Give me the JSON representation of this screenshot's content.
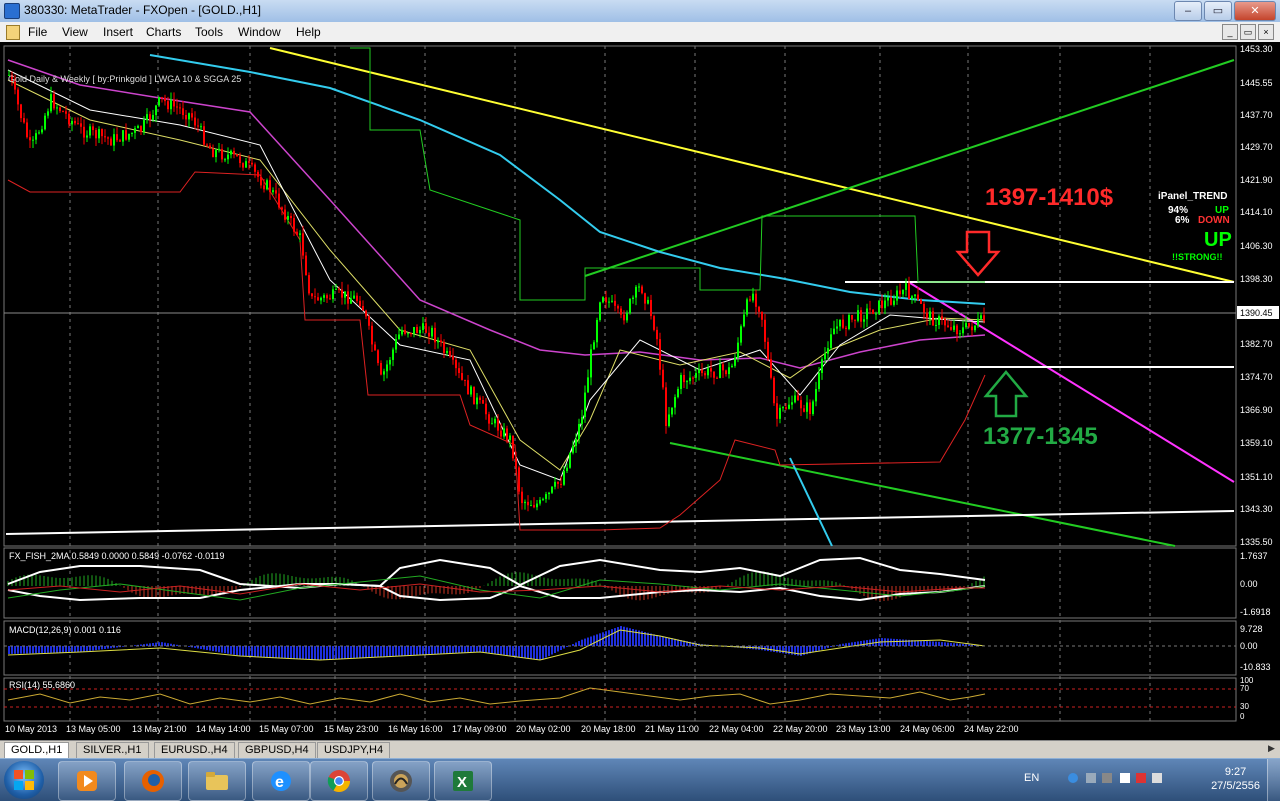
{
  "window": {
    "title": "380330: MetaTrader - FXOpen - [GOLD.,H1]",
    "minimize": "–",
    "maximize": "▭",
    "close": "✕"
  },
  "menu": [
    "File",
    "View",
    "Insert",
    "Charts",
    "Tools",
    "Window",
    "Help"
  ],
  "mdi_buttons": [
    "_",
    "▭",
    "×"
  ],
  "chart": {
    "indicator_label": "Gold Daily & Weekly [ by:Prinkgold ]  LWGA 10  &  SGGA 25",
    "price_axis": [
      "1453.30",
      "1445.55",
      "1437.70",
      "1429.70",
      "1421.90",
      "1414.10",
      "1406.30",
      "1398.30",
      "1390.45",
      "1382.70",
      "1374.70",
      "1366.90",
      "1359.10",
      "1351.10",
      "1343.30",
      "1335.50"
    ],
    "current_price": "1390.45",
    "annotation_resistance": "1397-1410$",
    "annotation_support": "1377-1345",
    "ipanel": {
      "title": "iPanel_TREND",
      "up_pct": "94%",
      "up_label": "UP",
      "down_pct": "6%",
      "down_label": "DOWN",
      "big": "UP",
      "strength": "!!STRONG!!"
    },
    "colors": {
      "bull": "#00ff00",
      "bear": "#ff0000",
      "resistance": "#ff2a2a",
      "support": "#22aa44"
    }
  },
  "fisher": {
    "label": "FX_FISH_2MA 0.5849 0.0000 0.5849 -0.0762 -0.0119",
    "axis": [
      "1.7637",
      "0.00",
      "-1.6918"
    ]
  },
  "macd": {
    "label": "MACD(12,26,9) 0.001 0.116",
    "axis": [
      "9.728",
      "0.00",
      "-10.833"
    ]
  },
  "rsi": {
    "label": "RSI(14) 55.6860",
    "axis": [
      "100",
      "70",
      "30",
      "0"
    ]
  },
  "time_axis": [
    "10 May 2013",
    "13 May 05:00",
    "13 May 21:00",
    "14 May 14:00",
    "15 May 07:00",
    "15 May 23:00",
    "16 May 16:00",
    "17 May 09:00",
    "20 May 02:00",
    "20 May 18:00",
    "21 May 11:00",
    "22 May 04:00",
    "22 May 20:00",
    "23 May 13:00",
    "24 May 06:00",
    "24 May 22:00"
  ],
  "tabs": [
    "GOLD.,H1",
    "SILVER.,H1",
    "EURUSD.,H4",
    "GBPUSD,H4",
    "USDJPY,H4"
  ],
  "tray": {
    "lang": "EN",
    "time": "9:27",
    "date": "27/5/2556"
  },
  "taskbar_icons": [
    "media-player-icon",
    "firefox-icon",
    "folder-icon",
    "ie-icon",
    "chrome-icon",
    "metatrader-icon",
    "excel-icon"
  ]
}
